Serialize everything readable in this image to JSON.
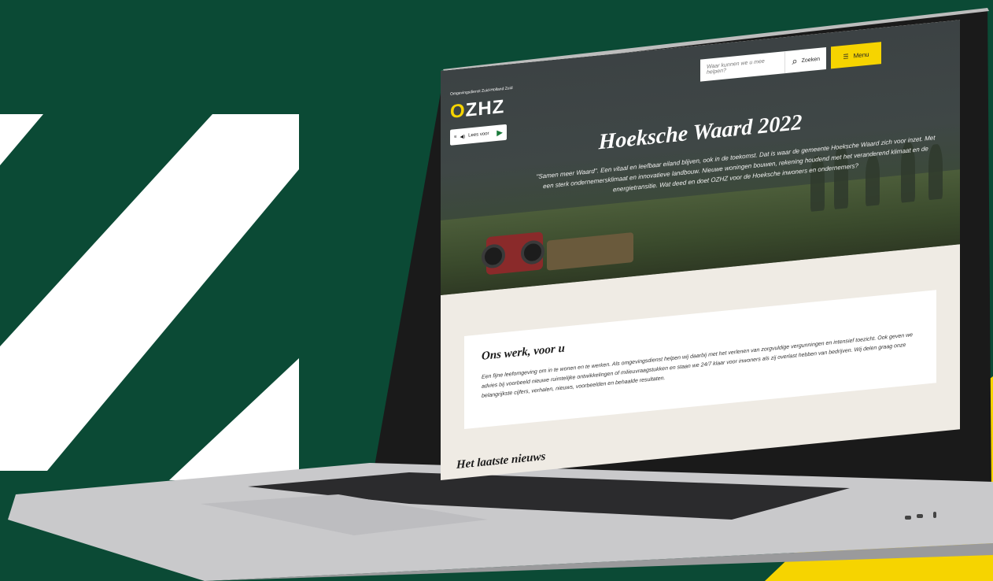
{
  "brand": {
    "colors": {
      "background": "#0b4a35",
      "accent": "#f6d400",
      "white": "#ffffff"
    },
    "logo_subtitle": "Omgevingsdienst Zuid-Holland Zuid",
    "logo_text": "OZHZ"
  },
  "header": {
    "read_button_label": "Lees voor",
    "search_placeholder": "Waar kunnen we u mee helpen?",
    "search_button_label": "Zoeken",
    "menu_button_label": "Menu"
  },
  "hero": {
    "title": "Hoeksche Waard 2022",
    "intro": "\"Samen meer Waard\". Een vitaal en leefbaar eiland blijven, ook in de toekomst. Dat is waar de gemeente Hoeksche Waard zich voor inzet. Met een sterk ondernemersklimaat en innovatieve landbouw. Nieuwe woningen bouwen, rekening houdend met het veranderend klimaat en de energietransitie. Wat deed en doet OZHZ voor de Hoeksche inwoners en ondernemers?"
  },
  "work_section": {
    "title": "Ons werk, voor u",
    "body": "Een fijne leefomgeving om in te wonen en te werken. Als omgevingsdienst helpen wij daarbij met het verlenen van zorgvuldige vergunningen en intensief toezicht. Ook geven we advies bij voorbeeld nieuwe ruimtelijke ontwikkelingen of milieuvraagstukken en staan we 24/7 klaar voor inwoners als zij overlast hebben van bedrijven. Wij delen graag onze belangrijkste cijfers, verhalen, nieuws, voorbeelden en behaalde resultaten."
  },
  "news_section": {
    "title": "Het laatste nieuws"
  }
}
